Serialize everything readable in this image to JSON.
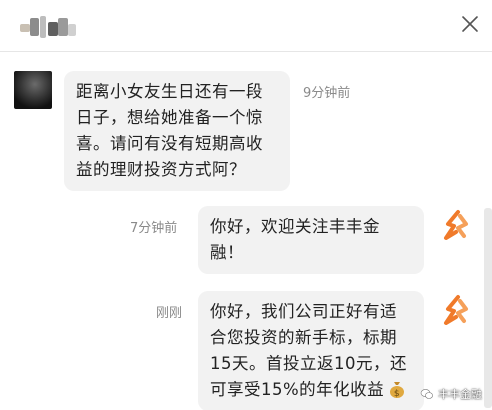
{
  "header": {
    "close_label": "×"
  },
  "messages": [
    {
      "sender": "user",
      "text_lines": [
        "距离小女友生日还有一段",
        "日子，想给她准备一个惊",
        "喜。请问有没有短期高收",
        "益的理财投资方式阿？"
      ],
      "time": "9分钟前"
    },
    {
      "sender": "brand",
      "text_lines": [
        "你好，欢迎关注丰丰金",
        "融！"
      ],
      "time": "7分钟前"
    },
    {
      "sender": "brand",
      "text_lines": [
        "你好，我们公司正好有适",
        "合您投资的新手标，标期",
        "15天。首投立返10元，还",
        "可享受15%的年化收益"
      ],
      "time": "刚刚",
      "trailing_icon": "money-bag-icon"
    }
  ],
  "watermark": {
    "text": "丰丰金融",
    "icon": "wechat-icon"
  },
  "colors": {
    "brand_orange": "#f07a2a",
    "bubble_bg": "#f2f2f2",
    "time_gray": "#8a8a8a"
  }
}
